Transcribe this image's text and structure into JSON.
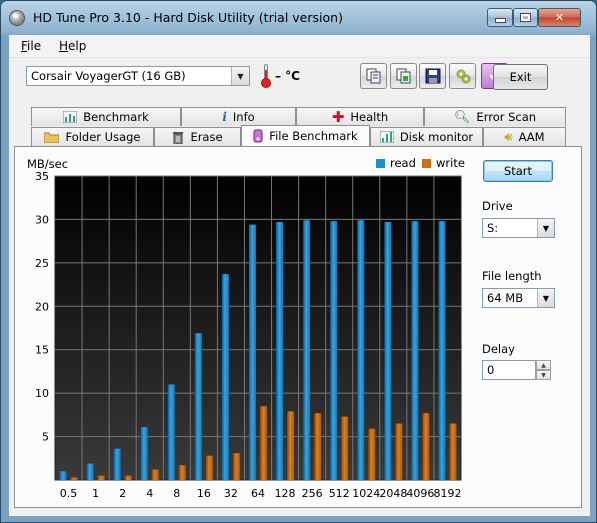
{
  "window": {
    "title": "HD Tune Pro 3.10 - Hard Disk Utility (trial version)"
  },
  "menu": [
    {
      "key": "F",
      "rest": "ile"
    },
    {
      "key": "H",
      "rest": "elp"
    }
  ],
  "toolbar": {
    "drive": "Corsair VoyagerGT (16 GB)",
    "temperature": "– °C",
    "exit_label": "Exit",
    "icons": [
      "copy-info-icon",
      "copy-screenshot-icon",
      "save-icon",
      "options-icon",
      "download-icon"
    ]
  },
  "tabs_row1": [
    "Benchmark",
    "Info",
    "Health",
    "Error Scan"
  ],
  "tabs_row2": [
    "Folder Usage",
    "Erase",
    "File Benchmark",
    "Disk monitor",
    "AAM"
  ],
  "active_tab": "File Benchmark",
  "side": {
    "start_label": "Start",
    "drive_label": "Drive",
    "drive_value": "S:",
    "file_length_label": "File length",
    "file_length_value": "64 MB",
    "delay_label": "Delay",
    "delay_value": "0"
  },
  "colors": {
    "read": "#1f8fd0",
    "write": "#d06d10"
  },
  "chart_data": {
    "type": "bar",
    "ylabel": "MB/sec",
    "ylim": [
      0,
      35
    ],
    "yticks": [
      5,
      10,
      15,
      20,
      25,
      30,
      35
    ],
    "categories": [
      "0.5",
      "1",
      "2",
      "4",
      "8",
      "16",
      "32",
      "64",
      "128",
      "256",
      "512",
      "1024",
      "2048",
      "4096",
      "8192"
    ],
    "series": [
      {
        "name": "read",
        "values": [
          1.0,
          1.9,
          3.6,
          6.1,
          11.0,
          16.9,
          23.7,
          29.4,
          29.7,
          29.9,
          29.8,
          29.9,
          29.7,
          29.8,
          29.8
        ]
      },
      {
        "name": "write",
        "values": [
          0.3,
          0.5,
          0.5,
          1.2,
          1.7,
          2.8,
          3.1,
          8.5,
          7.9,
          7.7,
          7.3,
          5.9,
          6.5,
          7.7,
          6.5
        ]
      }
    ],
    "legend": "top-right",
    "grid": true
  }
}
